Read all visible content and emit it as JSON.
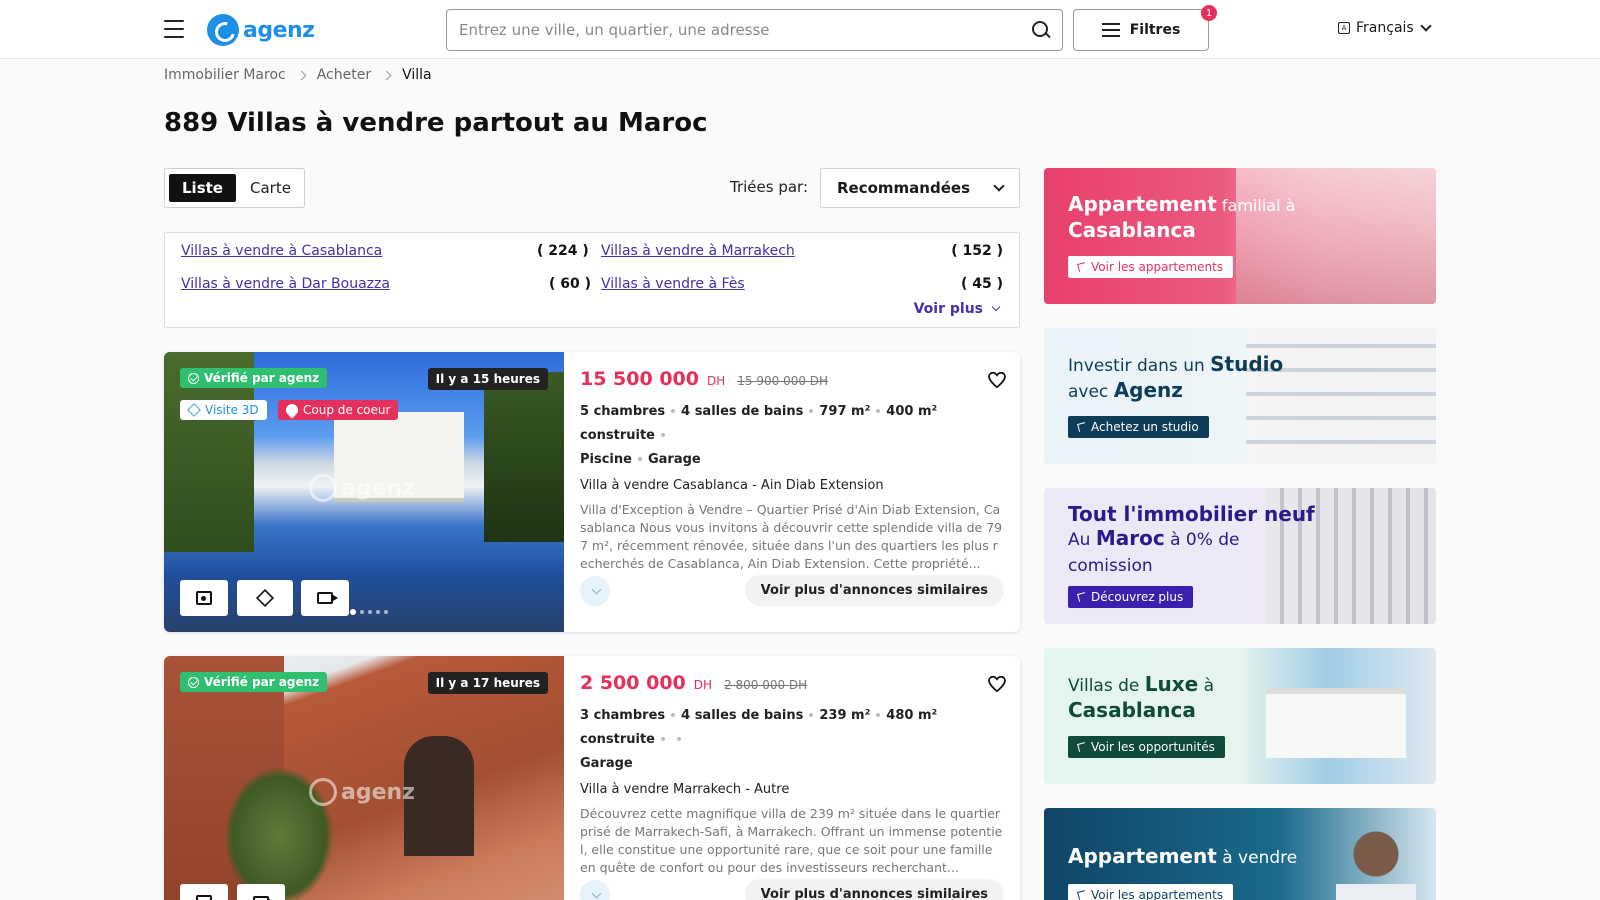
{
  "header": {
    "logo_text": "agenz",
    "search_placeholder": "Entrez une ville, un quartier, une adresse",
    "filters_label": "Filtres",
    "filters_badge": "1",
    "language": "Français"
  },
  "breadcrumb": [
    "Immobilier Maroc",
    "Acheter",
    "Villa"
  ],
  "title": {
    "bold": "889 Villas à vendre",
    "rest": " partout au Maroc"
  },
  "view_toggle": {
    "list": "Liste",
    "map": "Carte"
  },
  "sort": {
    "label": "Triées par:",
    "value": "Recommandées"
  },
  "city_links": [
    {
      "label": "Villas à vendre à Casablanca",
      "count": "( 224 )"
    },
    {
      "label": "Villas à vendre à Marrakech",
      "count": "( 152 )"
    },
    {
      "label": "Villas à vendre à Dar Bouazza",
      "count": "( 60 )"
    },
    {
      "label": "Villas à vendre à Fès",
      "count": "( 45 )"
    }
  ],
  "voir_plus": "Voir plus",
  "listings": [
    {
      "verified": "Vérifié par agenz",
      "time": "Il y a 15 heures",
      "badge_3d": "Visite 3D",
      "badge_heart": "Coup de coeur",
      "watermark": "agenz",
      "price": "15 500 000",
      "currency": "DH",
      "old_price": "15 900 000 DH",
      "feats_line1": [
        "5 chambres",
        "4 salles de bains",
        "797 m²",
        "400 m² construite"
      ],
      "feats_line2": [
        "Piscine",
        "Garage"
      ],
      "location": "Villa à vendre Casablanca - Ain Diab Extension",
      "description": "Villa d'Exception à Vendre – Quartier Prisé d'Ain Diab Extension, Casablanca Nous vous invitons à découvrir cette splendide villa de 797 m², récemment rénovée, située dans l'un des quartiers les plus recherchés de Casablanca, Ain Diab Extension. Cette propriété...",
      "similar": "Voir plus d'annonces similaires"
    },
    {
      "verified": "Vérifié par agenz",
      "time": "Il y a 17 heures",
      "watermark": "agenz",
      "price": "2 500 000",
      "currency": "DH",
      "old_price": "2 800 000 DH",
      "feats_line1": [
        "3 chambres",
        "4 salles de bains",
        "239 m²",
        "480 m² construite"
      ],
      "feats_line2": [
        "Garage"
      ],
      "location": "Villa à vendre Marrakech - Autre",
      "description": "Découvrez cette magnifique villa de 239 m² située dans le quartier prisé de Marrakech-Safi, à Marrakech. Offrant un immense potentiel, elle constitue une opportunité rare, que ce soit pour une famille en quête de confort ou pour des investisseurs recherchant...",
      "similar": "Voir plus d'annonces similaires"
    }
  ],
  "banners": [
    {
      "title_bold": "Appartement",
      "title_rest": " familial à",
      "title_line2": "Casablanca",
      "button": "Voir les appartements"
    },
    {
      "title_pre": "Investir dans un ",
      "title_bold": "Studio",
      "title_line2_pre": "avec ",
      "title_line2_bold": "Agenz",
      "button": "Achetez un studio"
    },
    {
      "title_bold": "Tout l'immobilier neuf",
      "title_line2_pre": "Au ",
      "title_line2_bold": "Maroc",
      "title_line2_rest": " à 0% de",
      "title_line3": "comission",
      "button": "Découvrez plus"
    },
    {
      "title_pre": "Villas de ",
      "title_bold": "Luxe",
      "title_rest": " à",
      "title_line2": "Casablanca",
      "button": "Voir les opportunités"
    },
    {
      "title_bold": "Appartement",
      "title_rest": " à vendre",
      "button": "Voir les appartements"
    }
  ],
  "colors": {
    "brand": "#1e8fe6",
    "price": "#e5305b",
    "link": "#4a2ea8",
    "verified": "#2fbf71"
  },
  "icons": [
    "menu-icon",
    "search-icon",
    "filter-icon",
    "language-icon",
    "chevron-down-icon",
    "heart-icon",
    "image-icon",
    "cube-icon",
    "video-icon",
    "check-icon",
    "flame-icon",
    "cursor-icon"
  ]
}
